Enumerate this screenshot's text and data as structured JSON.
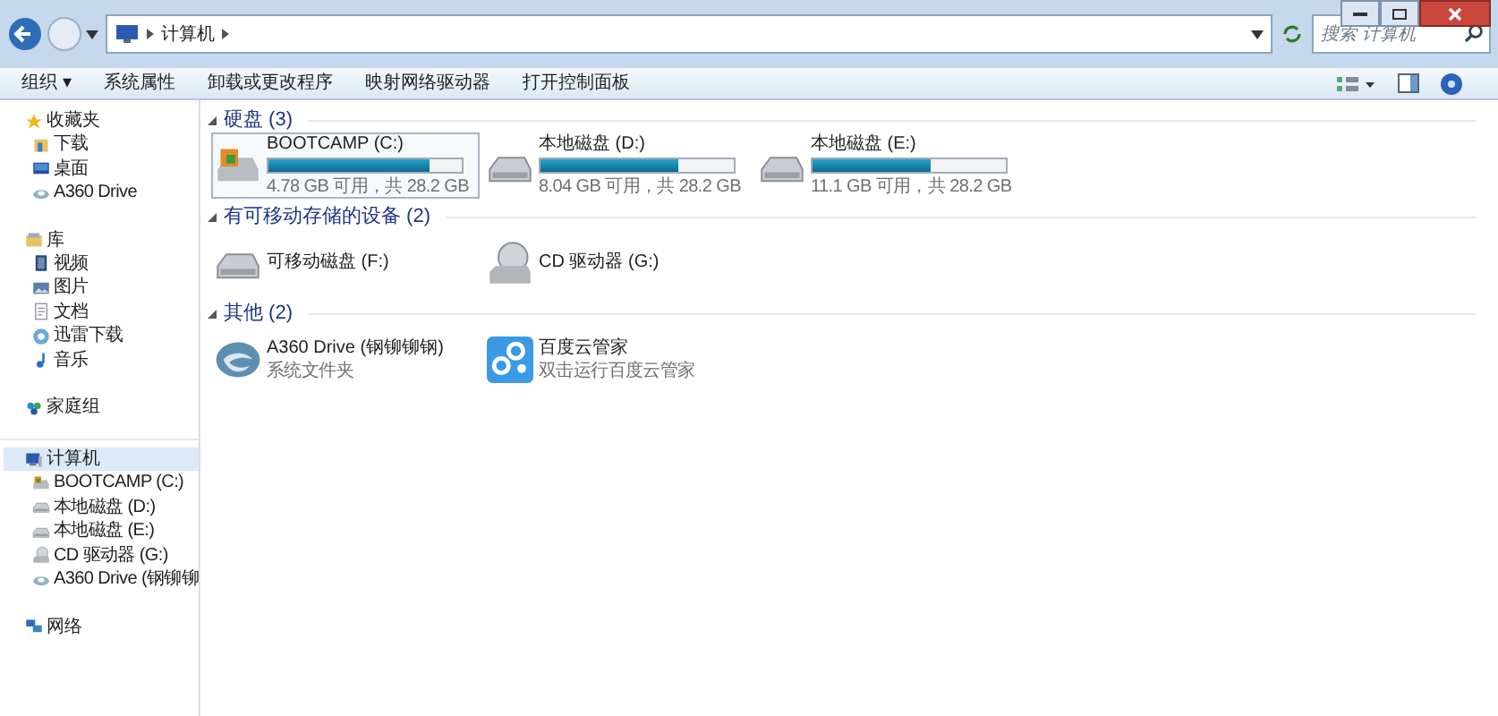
{
  "address": {
    "path": [
      "计算机"
    ],
    "search_placeholder": "搜索 计算机"
  },
  "toolbar": [
    "组织 ▾",
    "系统属性",
    "卸载或更改程序",
    "映射网络驱动器",
    "打开控制面板"
  ],
  "sidebar": [
    {
      "label": "收藏夹",
      "children": [
        {
          "label": "下载"
        },
        {
          "label": "桌面"
        },
        {
          "label": "A360 Drive"
        }
      ]
    },
    {
      "label": "库",
      "children": [
        {
          "label": "视频"
        },
        {
          "label": "图片"
        },
        {
          "label": "文档"
        },
        {
          "label": "迅雷下载"
        },
        {
          "label": "音乐"
        }
      ]
    },
    {
      "label": "家庭组"
    },
    {
      "label": "计算机",
      "selected": true,
      "children": [
        {
          "label": "BOOTCAMP (C:)"
        },
        {
          "label": "本地磁盘 (D:)"
        },
        {
          "label": "本地磁盘 (E:)"
        },
        {
          "label": "CD 驱动器 (G:)"
        },
        {
          "label": "A360 Drive (钢铆铆"
        }
      ]
    },
    {
      "label": "网络"
    }
  ],
  "groups": [
    {
      "title": "硬盘 (3)",
      "items": [
        {
          "kind": "disk",
          "name": "BOOTCAMP (C:)",
          "level": 0.83,
          "info": "4.78 GB 可用，共 28.2 GB",
          "selected": true
        },
        {
          "kind": "disk",
          "name": "本地磁盘 (D:)",
          "level": 0.715,
          "info": "8.04 GB 可用，共 28.2 GB",
          "selected": false
        },
        {
          "kind": "disk",
          "name": "本地磁盘 (E:)",
          "level": 0.61,
          "info": "11.1 GB 可用，共 28.2 GB",
          "selected": false
        }
      ]
    },
    {
      "title": "有可移动存储的设备 (2)",
      "items": [
        {
          "kind": "device",
          "name": "可移动磁盘 (F:)",
          "selected": false
        },
        {
          "kind": "device",
          "name": "CD 驱动器 (G:)",
          "selected": false
        }
      ]
    },
    {
      "title": "其他 (2)",
      "items": [
        {
          "kind": "app",
          "name": "A360 Drive (钢铆铆钢)",
          "info": "系统文件夹",
          "selected": false
        },
        {
          "kind": "app",
          "name": "百度云管家",
          "info": "双击运行百度云管家",
          "selected": false
        }
      ]
    }
  ]
}
